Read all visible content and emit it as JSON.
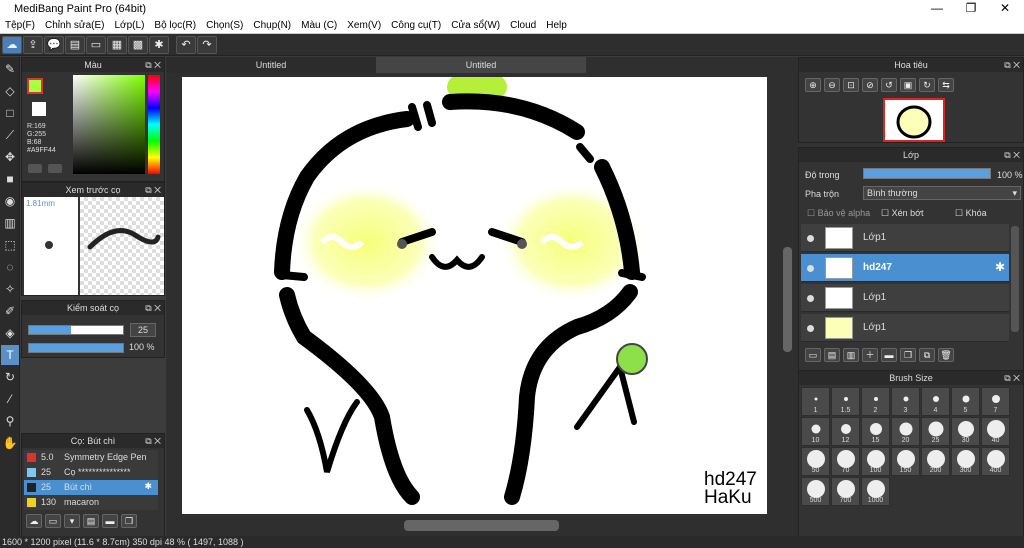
{
  "window": {
    "title": "MediBang Paint Pro (64bit)",
    "minimize": "—",
    "maximize": "❐",
    "close": "✕"
  },
  "menu": [
    "Tệp(F)",
    "Chỉnh sửa(E)",
    "Lớp(L)",
    "Bộ lọc(R)",
    "Chọn(S)",
    "Chụp(N)",
    "Màu (C)",
    "Xem(V)",
    "Công cụ(T)",
    "Cửa sổ(W)",
    "Cloud",
    "Help"
  ],
  "tabs": [
    {
      "label": "Untitled"
    },
    {
      "label": "Untitled"
    }
  ],
  "color_panel": {
    "title": "Màu",
    "r": "R:169",
    "g": "G:255",
    "b": "B:68",
    "hex": "#A9FF44",
    "accent": "#A9FF44"
  },
  "preview_panel": {
    "title": "Xem trước cọ",
    "size": "1.81mm"
  },
  "brush_control": {
    "title": "Kiểm soát cọ",
    "size_value": "25",
    "opacity_value": "100 %",
    "size_fill": 0.45,
    "opacity_fill": 1.0
  },
  "brush_panel": {
    "title": "Cọ: Bút chì",
    "items": [
      {
        "size": "5.0",
        "name": "Symmetry Edge Pen",
        "color": "#e03030",
        "selected": false
      },
      {
        "size": "25",
        "name": "Cọ ***************",
        "color": "#7ec8f0",
        "selected": false
      },
      {
        "size": "25",
        "name": "Bút chì",
        "color": "#222222",
        "selected": true
      },
      {
        "size": "130",
        "name": "macaron",
        "color": "#f0d020",
        "selected": false
      }
    ]
  },
  "navigator": {
    "title": "Hoa tiêu"
  },
  "layer_panel": {
    "title": "Lớp",
    "opacity_label": "Độ trong",
    "opacity_value": "100 %",
    "blend_label": "Pha trộn",
    "blend_value": "Bình thường",
    "protect_alpha": "Bảo vệ alpha",
    "clipping": "Xén bớt",
    "lock": "Khóa",
    "layers": [
      {
        "name": "Lớp1",
        "selected": false,
        "thumb": "char"
      },
      {
        "name": "hd247",
        "selected": true,
        "thumb": "text"
      },
      {
        "name": "Lớp1",
        "selected": false,
        "thumb": "char"
      },
      {
        "name": "Lớp1",
        "selected": false,
        "thumb": "yellow"
      }
    ]
  },
  "brush_size": {
    "title": "Brush Size",
    "sizes": [
      "1",
      "1.5",
      "2",
      "3",
      "4",
      "5",
      "7",
      "10",
      "12",
      "15",
      "20",
      "25",
      "30",
      "40",
      "50",
      "70",
      "100",
      "150",
      "200",
      "300",
      "400",
      "500",
      "700",
      "1000"
    ]
  },
  "canvas": {
    "sign_line1": "hd247",
    "sign_line2": "HaKu"
  },
  "status": {
    "text": "1600 * 1200 pixel   (11.6 * 8.7cm)   350 dpi   48 %   ( 1497, 1088 )"
  }
}
